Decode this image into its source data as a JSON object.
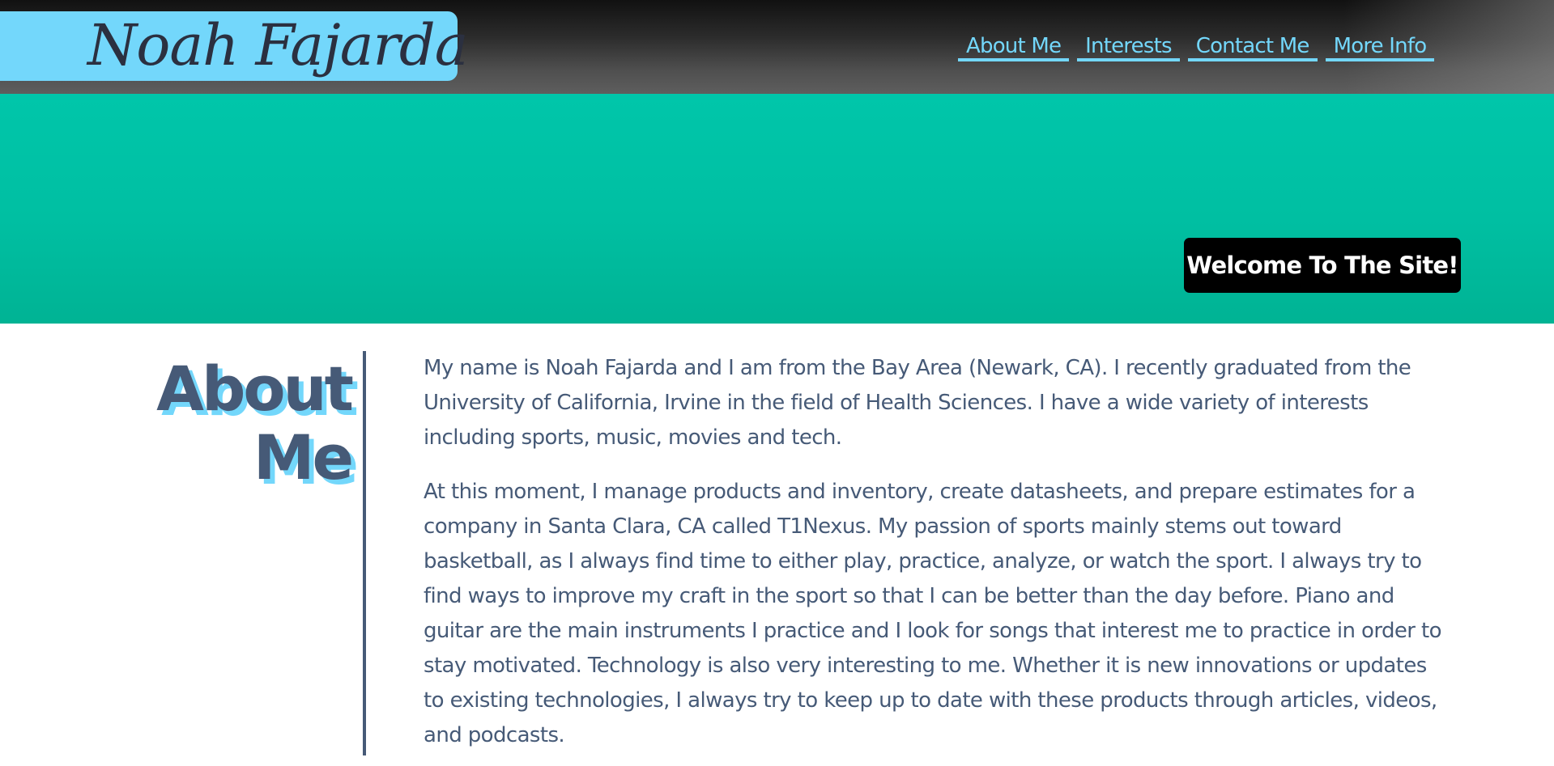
{
  "header": {
    "logo_text": "Noah Fajarda",
    "nav": [
      {
        "label": "About Me"
      },
      {
        "label": "Interests"
      },
      {
        "label": "Contact Me"
      },
      {
        "label": "More Info"
      }
    ]
  },
  "hero": {
    "welcome_text": "Welcome To The Site!"
  },
  "about": {
    "title_line1": "About",
    "title_line2": "Me",
    "paragraphs": [
      "My name is Noah Fajarda and I am from the Bay Area (Newark, CA). I recently graduated from the University of California, Irvine in the field of Health Sciences. I have a wide variety of interests including sports, music, movies and tech.",
      "At this moment, I manage products and inventory, create datasheets, and prepare estimates for a company in Santa Clara, CA called T1Nexus. My passion of sports mainly stems out toward basketball, as I always find time to either play, practice, analyze, or watch the sport. I always try to find ways to improve my craft in the sport so that I can be better than the day before. Piano and guitar are the main instruments I practice and I look for songs that interest me to practice in order to stay motivated. Technology is also very interesting to me. Whether it is new innovations or updates to existing technologies, I always try to keep up to date with these products through articles, videos, and podcasts."
    ]
  },
  "colors": {
    "accent": "#73d7fb",
    "hero": "#00c0a3",
    "text": "#465a77"
  }
}
